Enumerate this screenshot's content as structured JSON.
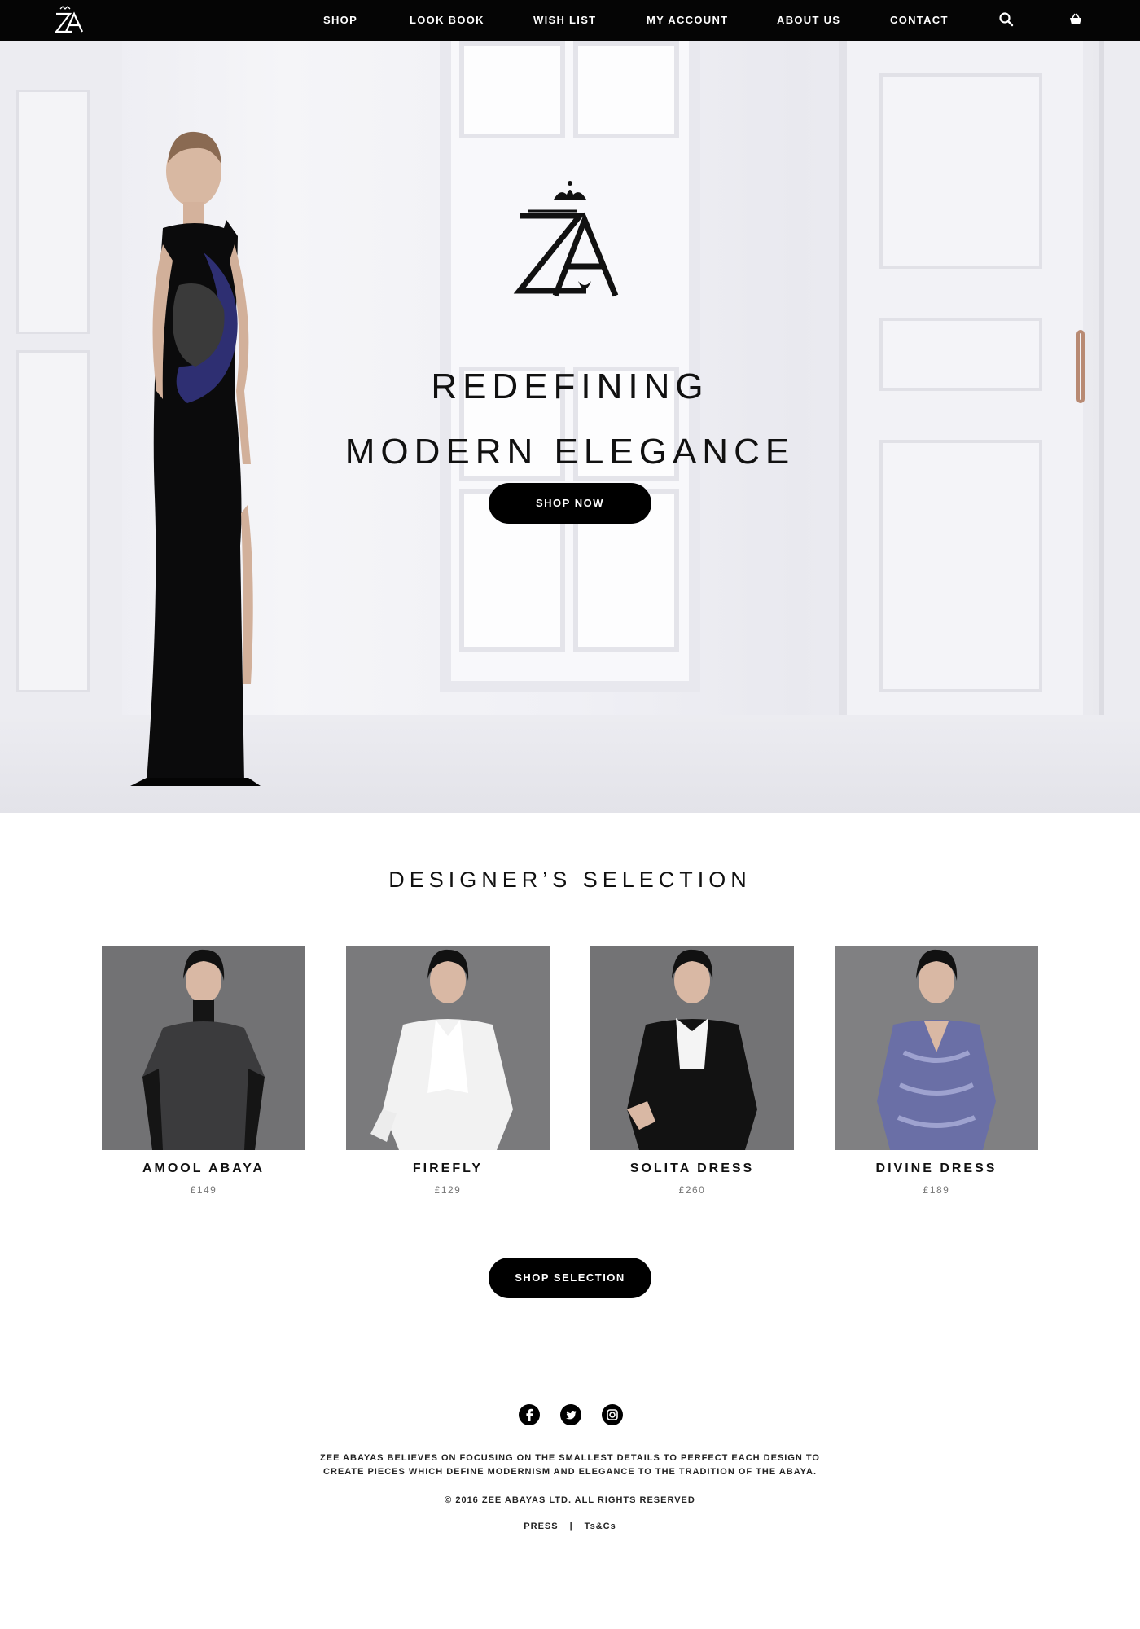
{
  "nav": {
    "logo_text": "ZA",
    "links": [
      "SHOP",
      "LOOK BOOK",
      "WISH LIST",
      "MY ACCOUNT",
      "ABOUT US",
      "CONTACT"
    ],
    "search_icon": "search-icon",
    "basket_icon": "basket-icon"
  },
  "hero": {
    "logo_text": "ZA",
    "title_line1": "REDEFINING",
    "title_line2": "MODERN ELEGANCE",
    "cta": "SHOP NOW"
  },
  "selection": {
    "title": "DESIGNER’S SELECTION",
    "products": [
      {
        "name": "AMOOL ABAYA",
        "price": "£149"
      },
      {
        "name": "FIREFLY",
        "price": "£129"
      },
      {
        "name": "SOLITA DRESS",
        "price": "£260"
      },
      {
        "name": "DIVINE DRESS",
        "price": "£189"
      }
    ],
    "cta": "SHOP SELECTION"
  },
  "footer": {
    "social_icons": [
      "facebook-icon",
      "twitter-icon",
      "instagram-icon"
    ],
    "about_line1": "ZEE ABAYAS BELIEVES ON FOCUSING ON THE SMALLEST DETAILS TO PERFECT EACH DESIGN TO",
    "about_line2": "CREATE PIECES WHICH DEFINE MODERNISM AND ELEGANCE TO THE TRADITION OF THE ABAYA.",
    "copyright": "© 2016 ZEE ABAYAS LTD. ALL RIGHTS RESERVED",
    "links": [
      "PRESS",
      "Ts&Cs"
    ],
    "separator": "|"
  },
  "colors": {
    "nav_bg": "#050505",
    "button_bg": "#000000",
    "price_text": "#777777"
  }
}
